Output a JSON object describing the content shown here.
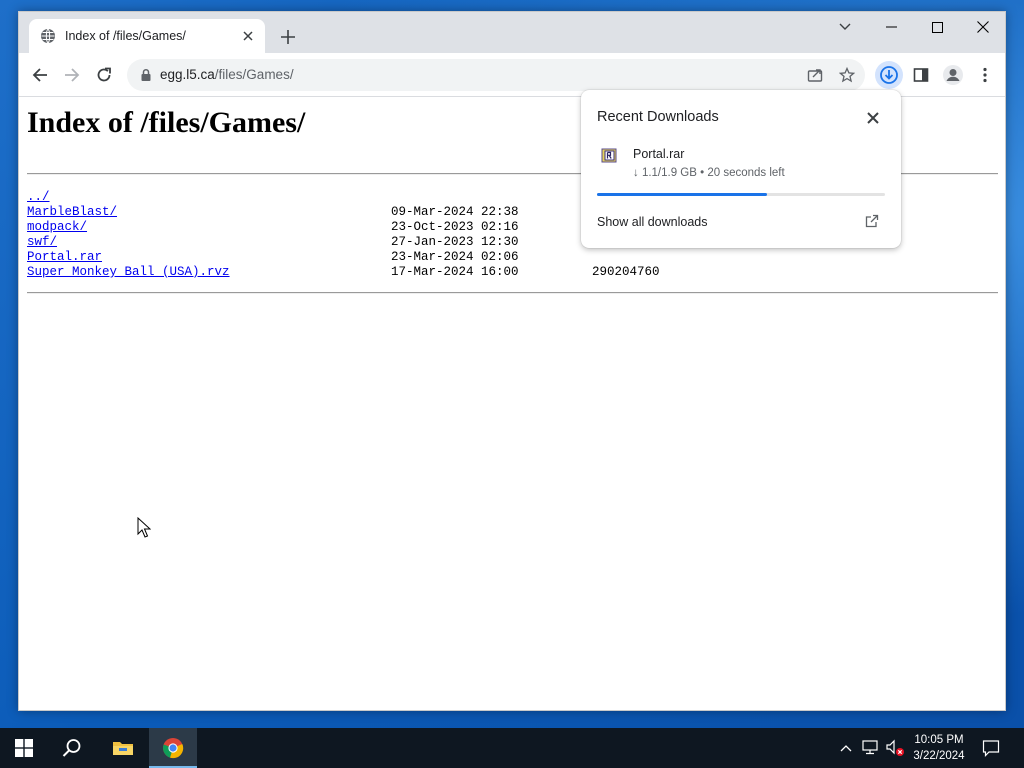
{
  "browser": {
    "tab": {
      "title": "Index of /files/Games/"
    },
    "address": {
      "host": "egg.l5.ca",
      "path": "/files/Games/"
    }
  },
  "page": {
    "heading": "Index of /files/Games/",
    "entries": [
      {
        "name": "../",
        "date": "",
        "size": ""
      },
      {
        "name": "MarbleBlast/",
        "date": "09-Mar-2024 22:38",
        "size": ""
      },
      {
        "name": "modpack/",
        "date": "23-Oct-2023 02:16",
        "size": ""
      },
      {
        "name": "swf/",
        "date": "27-Jan-2023 12:30",
        "size": ""
      },
      {
        "name": "Portal.rar",
        "date": "23-Mar-2024 02:06",
        "size": ""
      },
      {
        "name": "Super Monkey Ball (USA).rvz",
        "date": "17-Mar-2024 16:00",
        "size": "290204760"
      }
    ]
  },
  "downloads_bubble": {
    "title": "Recent Downloads",
    "item": {
      "filename": "Portal.rar",
      "status": "↓ 1.1/1.9 GB • 20 seconds left",
      "progress": 0.59
    },
    "show_all_label": "Show all downloads"
  },
  "taskbar": {
    "time": "10:05 PM",
    "date": "3/22/2024"
  },
  "colors": {
    "accent": "#1a73e8",
    "link": "#0000ee",
    "taskbar": "#0e1721"
  }
}
